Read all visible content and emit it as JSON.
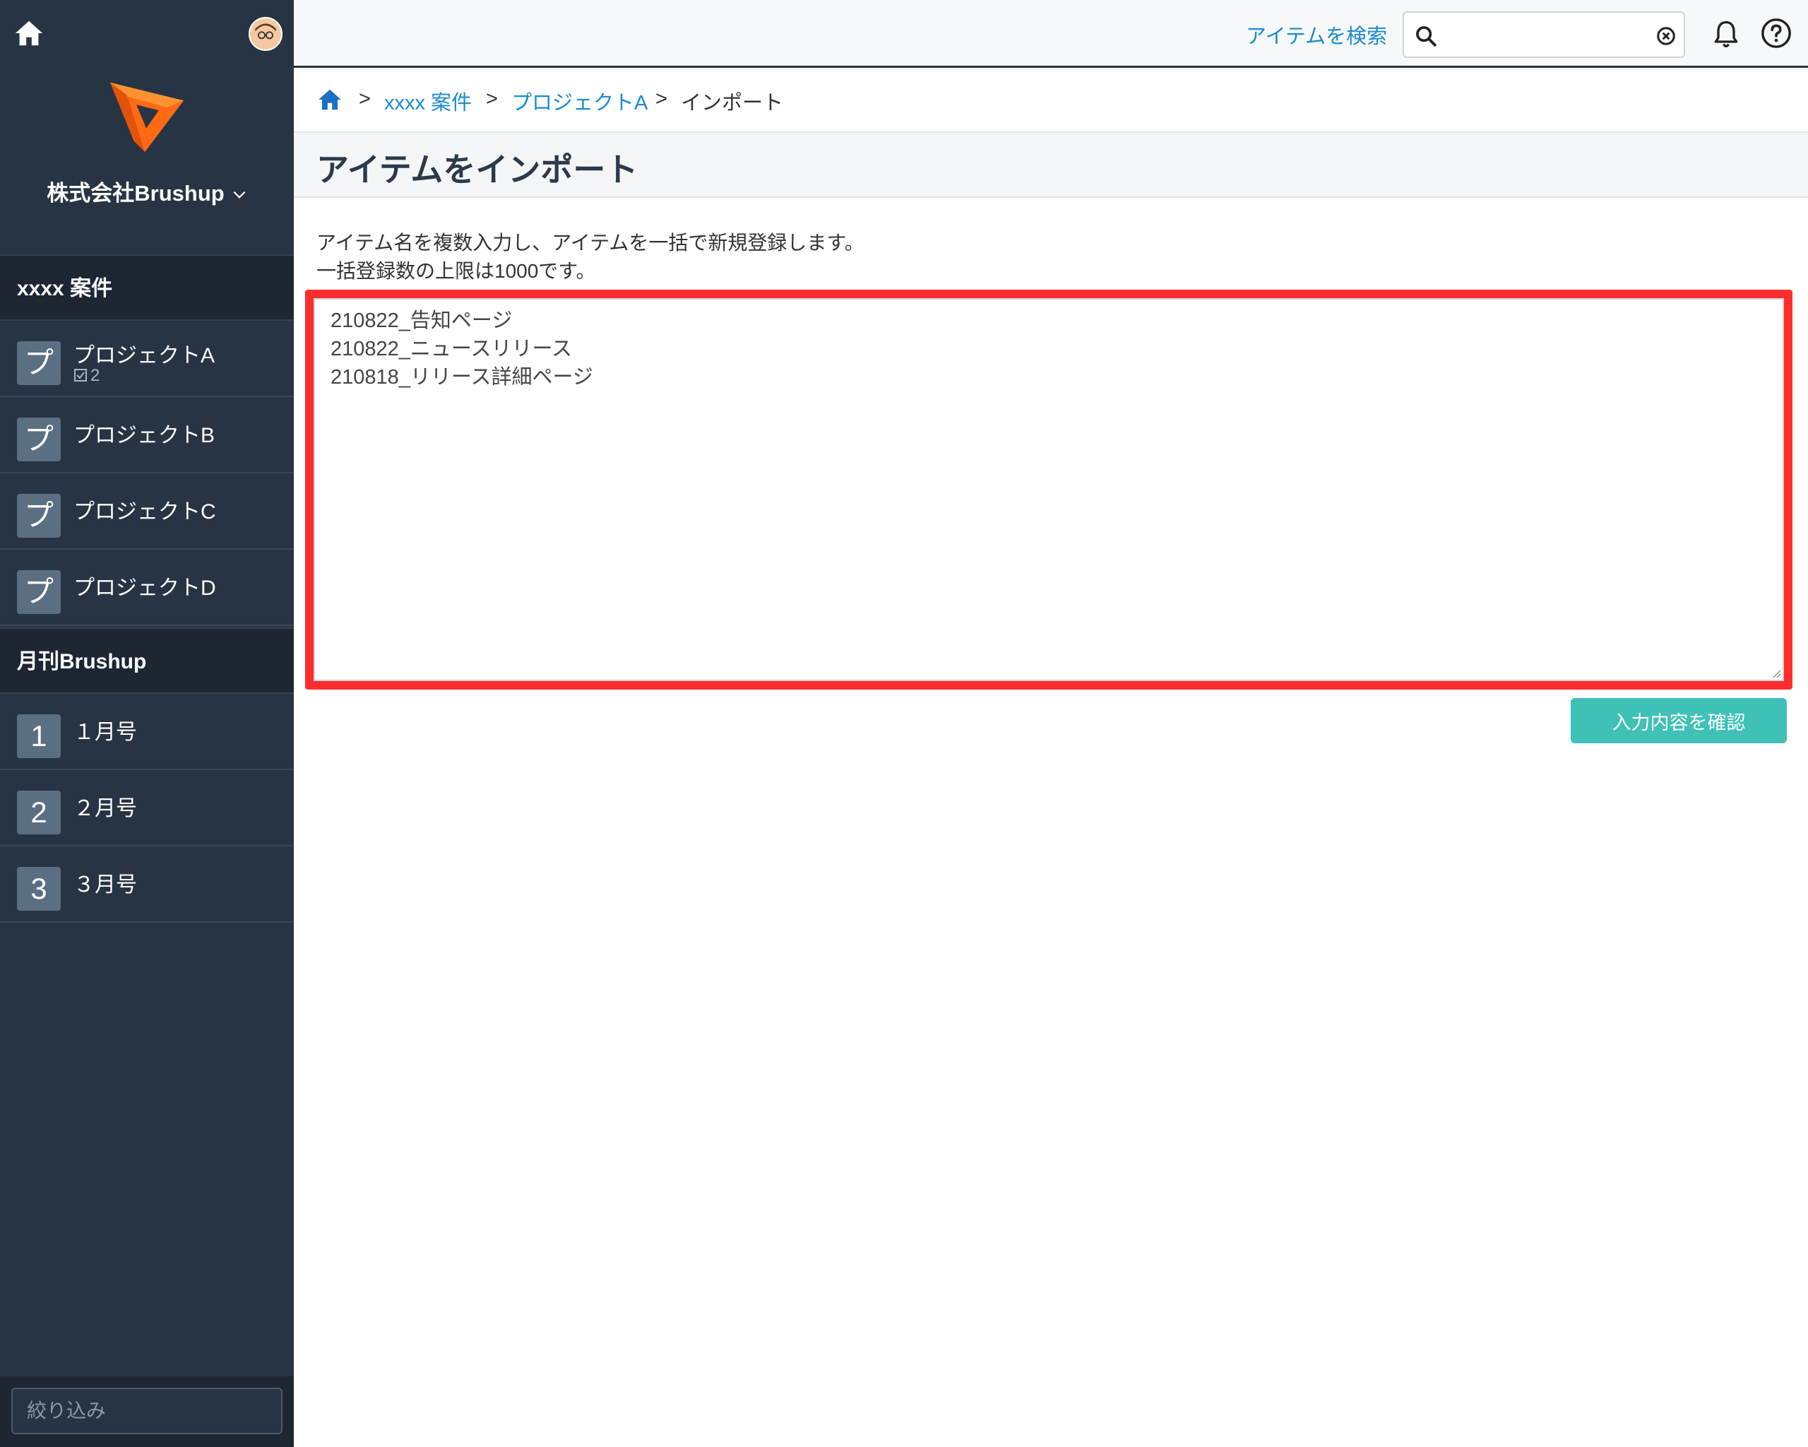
{
  "sidebar": {
    "org_name": "株式会社Brushup",
    "sections": [
      {
        "title": "xxxx 案件",
        "items": [
          {
            "tile": "プ",
            "label": "プロジェクトA",
            "badge_count": "2"
          },
          {
            "tile": "プ",
            "label": "プロジェクトB"
          },
          {
            "tile": "プ",
            "label": "プロジェクトC"
          },
          {
            "tile": "プ",
            "label": "プロジェクトD"
          }
        ]
      },
      {
        "title": "月刊Brushup",
        "items": [
          {
            "tile": "1",
            "label": "１月号"
          },
          {
            "tile": "2",
            "label": "２月号"
          },
          {
            "tile": "3",
            "label": "３月号"
          }
        ]
      }
    ],
    "filter_placeholder": "絞り込み"
  },
  "topbar": {
    "search_label": "アイテムを検索",
    "search_value": ""
  },
  "breadcrumb": {
    "items": [
      "xxxx 案件",
      "プロジェクトA"
    ],
    "current": "インポート",
    "separator": ">"
  },
  "page": {
    "title": "アイテムをインポート",
    "description_line1": "アイテム名を複数入力し、アイテムを一括で新規登録します。",
    "description_line2": "一括登録数の上限は1000です。",
    "textarea_value": "210822_告知ページ\n210822_ニュースリリース\n210818_リリース詳細ページ",
    "confirm_button": "入力内容を確認"
  },
  "colors": {
    "sidebar_bg": "#273444",
    "link": "#1a8bd0",
    "highlight_frame": "#ff2d2d",
    "confirm_button": "#3fc1b6",
    "logo_orange": "#ff6a13"
  },
  "icons": [
    "home-icon",
    "avatar",
    "brushup-logo",
    "chevron-down-icon",
    "check-icon",
    "search-icon",
    "clear-icon",
    "bell-icon",
    "help-icon"
  ]
}
